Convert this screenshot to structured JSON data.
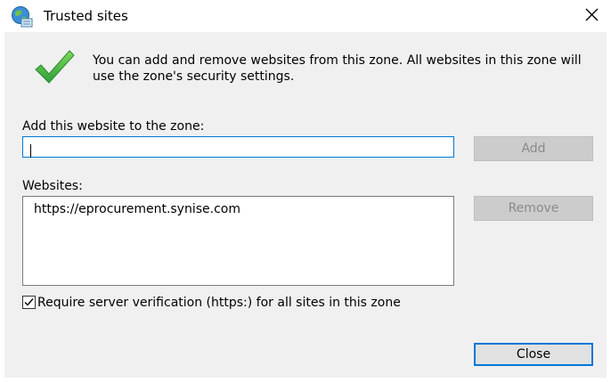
{
  "window": {
    "title": "Trusted sites",
    "title_icon": "trusted-sites-globe-icon",
    "close_icon": "close-icon"
  },
  "intro": {
    "icon": "green-checkmark-icon",
    "icon_color": "#4caf50",
    "text": "You can add and remove websites from this zone. All websites in this zone will use the zone's security settings."
  },
  "add_section": {
    "label": "Add this website to the zone:",
    "input_value": "",
    "add_button_label": "Add",
    "add_button_enabled": false
  },
  "websites_section": {
    "label": "Websites:",
    "sites": [
      "https://eprocurement.synise.com"
    ],
    "remove_button_label": "Remove",
    "remove_button_enabled": false
  },
  "verification": {
    "checked": true,
    "label": "Require server verification (https:) for all sites in this zone"
  },
  "footer": {
    "close_button_label": "Close"
  },
  "colors": {
    "dialog_background": "#f0f0f0",
    "accent": "#0078d7",
    "disabled_button": "#cccccc"
  }
}
